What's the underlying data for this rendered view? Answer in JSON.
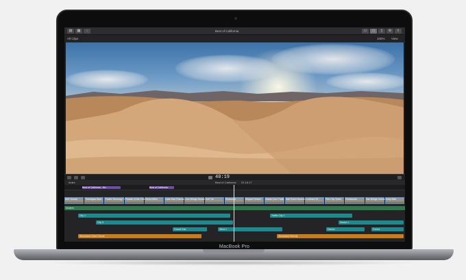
{
  "device": {
    "brand_label": "MacBook Pro"
  },
  "app": {
    "library_label": "All Clips",
    "window_title": "Best of California",
    "zoom_label": "100%",
    "view_label": "View",
    "project_label": "Best of California",
    "timecode": "40:19",
    "duration": "01:18:17",
    "index_label": "Index"
  },
  "timeline": {
    "purple_labels": [
      "Best of California - Mo",
      "Best of California"
    ],
    "clip_labels": [
      "IMG Sunset",
      "Timelapse Boat",
      "Pacific Running Trail",
      "Parade of the Cities",
      "Sierra Mtns",
      "Gate San Francisco",
      "San Bridge Sunset",
      "Surf Tar",
      "Redwood",
      "Mojave Desert",
      "Santa Cruz Trails",
      "Salt Tower Sunset",
      "Lombard St.",
      "Pier City Trees",
      "Redwoods",
      "San Bridge Cinema",
      "Holly Bike"
    ],
    "green_label": "Modern",
    "teal_labels": [
      "City 1",
      "Traffic City 1",
      "City 3",
      "Desert 1",
      "Gravel Sub",
      "Wind 1",
      "Harbor",
      "Forest"
    ],
    "orange_labels": [
      "Woodwind Solo/Chorus",
      "Woodwind Melody"
    ]
  },
  "colors": {
    "green_track": "#2f7a4f",
    "teal_track": "#1e8a8f",
    "orange_track": "#c77d1d",
    "purple_marker": "#6d4ea8"
  }
}
